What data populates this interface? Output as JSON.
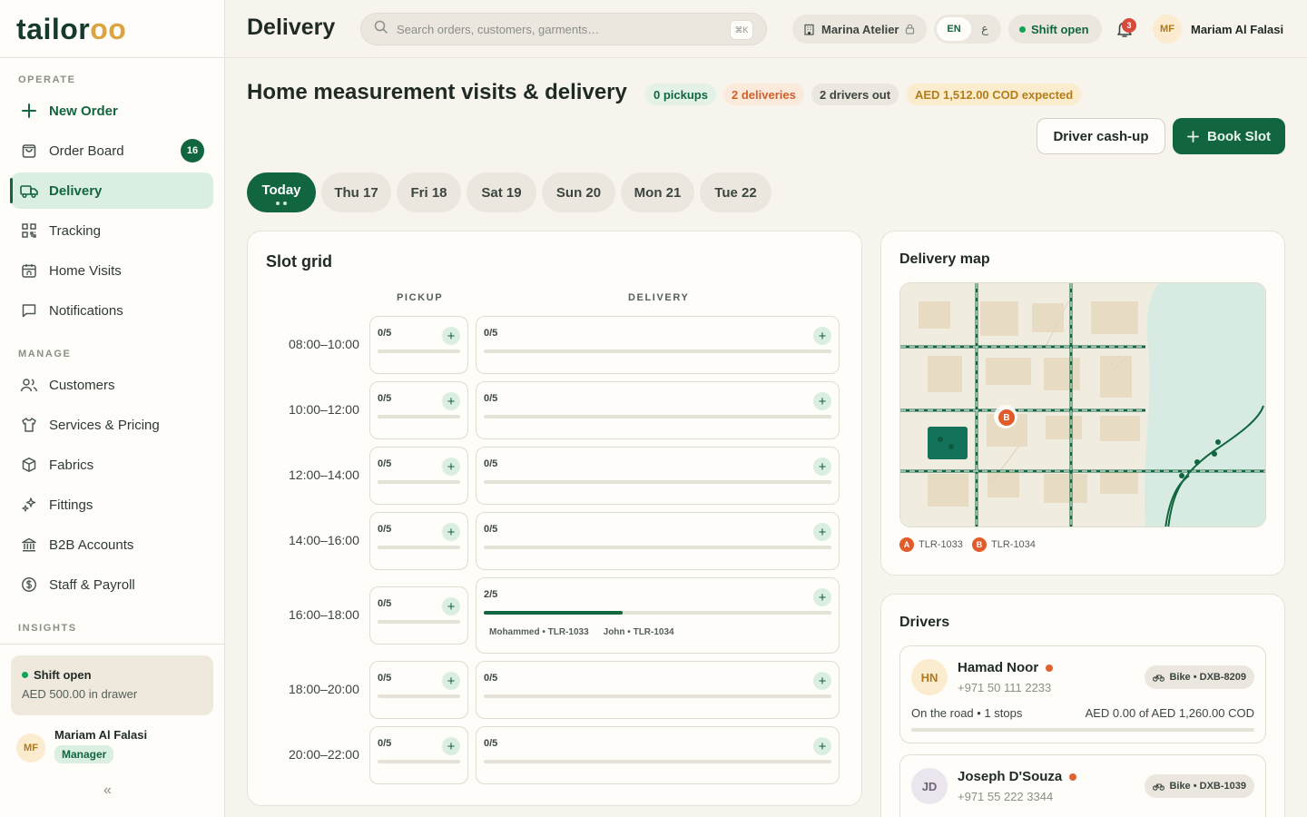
{
  "brand": {
    "logo_main": "tailor",
    "logo_accent": "oo"
  },
  "sidebar": {
    "sections": {
      "operate": "OPERATE",
      "manage": "MANAGE",
      "insights": "INSIGHTS"
    },
    "operate_items": [
      {
        "label": "New Order",
        "icon": "plus-icon"
      },
      {
        "label": "Order Board",
        "icon": "bag-icon",
        "badge": "16"
      },
      {
        "label": "Delivery",
        "icon": "truck-icon",
        "active": true
      },
      {
        "label": "Tracking",
        "icon": "qr-icon"
      },
      {
        "label": "Home Visits",
        "icon": "calendar-home-icon"
      },
      {
        "label": "Notifications",
        "icon": "message-icon"
      }
    ],
    "manage_items": [
      {
        "label": "Customers",
        "icon": "users-icon"
      },
      {
        "label": "Services & Pricing",
        "icon": "shirt-icon"
      },
      {
        "label": "Fabrics",
        "icon": "box-icon"
      },
      {
        "label": "Fittings",
        "icon": "sparkle-icon"
      },
      {
        "label": "B2B Accounts",
        "icon": "bank-icon"
      },
      {
        "label": "Staff & Payroll",
        "icon": "dollar-icon"
      }
    ],
    "shift": {
      "title": "Shift open",
      "detail": "AED 500.00 in drawer"
    },
    "user": {
      "initials": "MF",
      "name": "Mariam Al Falasi",
      "role": "Manager"
    }
  },
  "topbar": {
    "title": "Delivery",
    "search_placeholder": "Search orders, customers, garments…",
    "search_kbd": "⌘K",
    "branch": "Marina Atelier",
    "lang_en": "EN",
    "lang_ar": "ع",
    "shift": "Shift open",
    "notifications_count": "3",
    "user_initials": "MF",
    "user_name": "Mariam Al Falasi"
  },
  "header": {
    "title": "Home measurement visits & delivery",
    "stats": {
      "pickups": "0 pickups",
      "deliveries": "2 deliveries",
      "drivers": "2 drivers out",
      "cod": "AED 1,512.00 COD expected"
    },
    "cashup_label": "Driver cash-up",
    "book_label": "Book Slot"
  },
  "days": [
    "Today",
    "Thu 17",
    "Fri 18",
    "Sat 19",
    "Sun 20",
    "Mon 21",
    "Tue 22"
  ],
  "slot_grid": {
    "title": "Slot grid",
    "col_pickup": "PICKUP",
    "col_delivery": "DELIVERY",
    "rows": [
      {
        "time": "08:00–10:00",
        "pickup": {
          "count": "0/5",
          "fill": 0
        },
        "delivery": {
          "count": "0/5",
          "fill": 0
        }
      },
      {
        "time": "10:00–12:00",
        "pickup": {
          "count": "0/5",
          "fill": 0
        },
        "delivery": {
          "count": "0/5",
          "fill": 0
        }
      },
      {
        "time": "12:00–14:00",
        "pickup": {
          "count": "0/5",
          "fill": 0
        },
        "delivery": {
          "count": "0/5",
          "fill": 0
        }
      },
      {
        "time": "14:00–16:00",
        "pickup": {
          "count": "0/5",
          "fill": 0
        },
        "delivery": {
          "count": "0/5",
          "fill": 0
        }
      },
      {
        "time": "16:00–18:00",
        "pickup": {
          "count": "0/5",
          "fill": 0
        },
        "delivery": {
          "count": "2/5",
          "fill": 0.4,
          "chips": [
            "Mohammed • TLR-1033",
            "John • TLR-1034"
          ]
        }
      },
      {
        "time": "18:00–20:00",
        "pickup": {
          "count": "0/5",
          "fill": 0
        },
        "delivery": {
          "count": "0/5",
          "fill": 0
        }
      },
      {
        "time": "20:00–22:00",
        "pickup": {
          "count": "0/5",
          "fill": 0
        },
        "delivery": {
          "count": "0/5",
          "fill": 0
        }
      }
    ]
  },
  "map": {
    "title": "Delivery map",
    "marker_b": "B",
    "legend": [
      {
        "mark": "A",
        "label": "TLR-1033"
      },
      {
        "mark": "B",
        "label": "TLR-1034"
      }
    ]
  },
  "drivers": {
    "title": "Drivers",
    "items": [
      {
        "initials": "HN",
        "name": "Hamad Noor",
        "phone": "+971 50 111 2233",
        "vehicle": "Bike • DXB-8209",
        "status": "On the road • 1 stops",
        "cod": "AED 0.00 of AED 1,260.00 COD"
      },
      {
        "initials": "JD",
        "name": "Joseph D'Souza",
        "phone": "+971 55 222 3344",
        "vehicle": "Bike • DXB-1039"
      }
    ]
  },
  "colors": {
    "accent": "#12663f",
    "cod": "#d9a441",
    "alert": "#d84a3a"
  }
}
